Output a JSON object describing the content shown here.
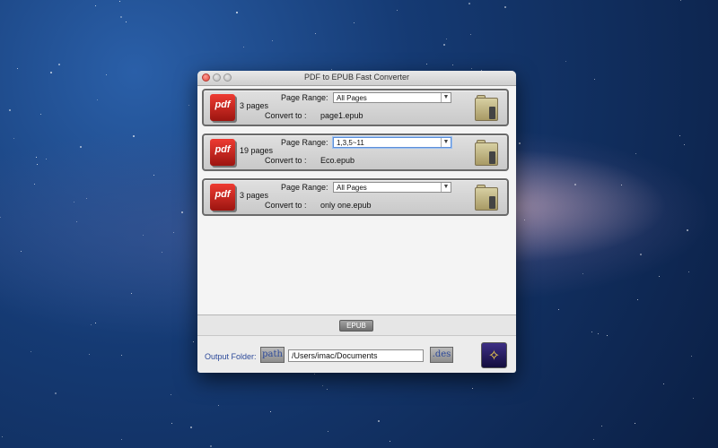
{
  "window": {
    "title": "PDF to EPUB Fast Converter"
  },
  "labels": {
    "page_range": "Page Range:",
    "convert_to": "Convert to :"
  },
  "files": [
    {
      "pages": "3 pages",
      "page_range": "All Pages",
      "output_name": "page1.epub",
      "icon": "pdf-icon"
    },
    {
      "pages": "19 pages",
      "page_range": "1,3,5~11",
      "output_name": "Eco.epub",
      "icon": "pdf-icon"
    },
    {
      "pages": "3 pages",
      "page_range": "All Pages",
      "output_name": "only one.epub",
      "icon": "pdf-icon"
    }
  ],
  "pdf_icon_text": "pdf",
  "format_button": "EPUB",
  "output": {
    "label": "Output Folder:",
    "path_button": "path",
    "path_value": "/Users/imac/Documents",
    "des_button": ".des"
  },
  "colors": {
    "accent_blue": "#2d4a9a",
    "pdf_red": "#d6261e",
    "run_button": "#2b1f66"
  }
}
